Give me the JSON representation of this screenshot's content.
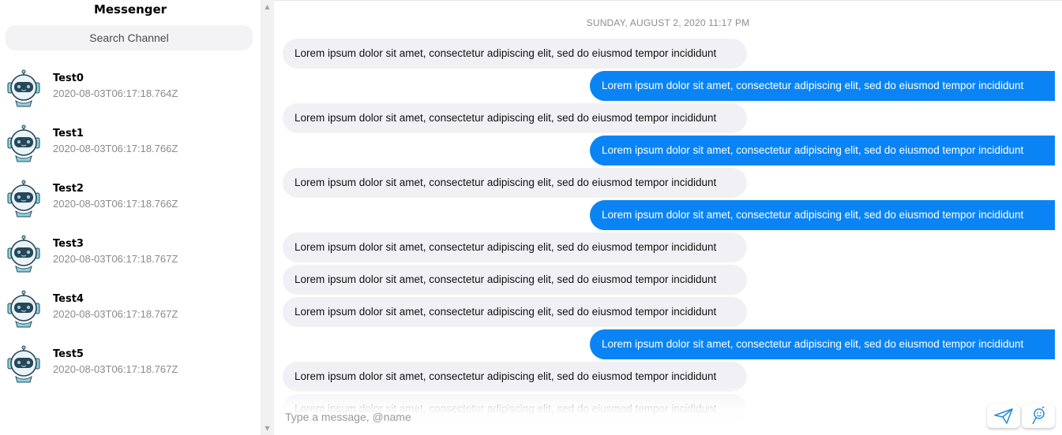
{
  "sidebar": {
    "title": "Messenger",
    "search_placeholder": "Search Channel",
    "channels": [
      {
        "name": "Test0",
        "time": "2020-08-03T06:17:18.764Z"
      },
      {
        "name": "Test1",
        "time": "2020-08-03T06:17:18.766Z"
      },
      {
        "name": "Test2",
        "time": "2020-08-03T06:17:18.766Z"
      },
      {
        "name": "Test3",
        "time": "2020-08-03T06:17:18.767Z"
      },
      {
        "name": "Test4",
        "time": "2020-08-03T06:17:18.767Z"
      },
      {
        "name": "Test5",
        "time": "2020-08-03T06:17:18.767Z"
      }
    ],
    "avatar_icon": "robot-avatar-icon"
  },
  "chat": {
    "date": "SUNDAY, AUGUST 2, 2020 11:17 PM",
    "messages": [
      {
        "dir": "in",
        "text": "Lorem ipsum dolor sit amet, consectetur adipiscing elit, sed do eiusmod tempor incididunt"
      },
      {
        "dir": "out",
        "text": "Lorem ipsum dolor sit amet, consectetur adipiscing elit, sed do eiusmod tempor incididunt"
      },
      {
        "dir": "in",
        "text": "Lorem ipsum dolor sit amet, consectetur adipiscing elit, sed do eiusmod tempor incididunt"
      },
      {
        "dir": "out",
        "text": "Lorem ipsum dolor sit amet, consectetur adipiscing elit, sed do eiusmod tempor incididunt"
      },
      {
        "dir": "in",
        "text": "Lorem ipsum dolor sit amet, consectetur adipiscing elit, sed do eiusmod tempor incididunt"
      },
      {
        "dir": "out",
        "text": "Lorem ipsum dolor sit amet, consectetur adipiscing elit, sed do eiusmod tempor incididunt"
      },
      {
        "dir": "in",
        "text": "Lorem ipsum dolor sit amet, consectetur adipiscing elit, sed do eiusmod tempor incididunt"
      },
      {
        "dir": "in",
        "text": "Lorem ipsum dolor sit amet, consectetur adipiscing elit, sed do eiusmod tempor incididunt"
      },
      {
        "dir": "in",
        "text": "Lorem ipsum dolor sit amet, consectetur adipiscing elit, sed do eiusmod tempor incididunt"
      },
      {
        "dir": "out",
        "text": "Lorem ipsum dolor sit amet, consectetur adipiscing elit, sed do eiusmod tempor incididunt"
      },
      {
        "dir": "in",
        "text": "Lorem ipsum dolor sit amet, consectetur adipiscing elit, sed do eiusmod tempor incididunt"
      },
      {
        "dir": "in",
        "text": "Lorem ipsum dolor sit amet, consectetur adipiscing elit, sed do eiusmod tempor incididunt"
      }
    ],
    "composer_placeholder": "Type a message, @name",
    "send_icon": "send-icon",
    "emoji_icon": "emoji-icon"
  },
  "colors": {
    "outgoing": "#0a84f5",
    "incoming": "#f1f0f4",
    "search_bg": "#f3f3f6"
  }
}
